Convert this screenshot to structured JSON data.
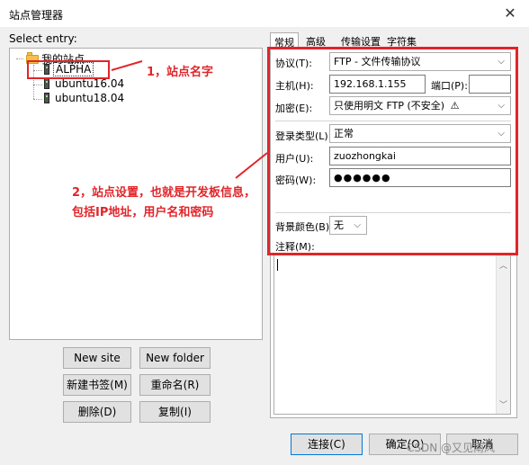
{
  "window": {
    "title": "站点管理器",
    "close_glyph": "✕"
  },
  "left": {
    "select_label": "Select entry:",
    "tree": {
      "root": "我的站点",
      "items": [
        "ALPHA",
        "ubuntu16.04",
        "ubuntu18.04"
      ]
    },
    "buttons": {
      "new_site": "New site",
      "new_folder": "New folder",
      "new_bookmark": "新建书签(M)",
      "rename": "重命名(R)",
      "delete": "删除(D)",
      "copy": "复制(I)"
    }
  },
  "tabs": [
    "常规",
    "高级",
    "传输设置",
    "字符集"
  ],
  "form": {
    "protocol": {
      "label": "协议(T):",
      "value": "FTP - 文件传输协议"
    },
    "host": {
      "label": "主机(H):",
      "value": "192.168.1.155"
    },
    "port": {
      "label": "端口(P):",
      "value": ""
    },
    "encryption": {
      "label": "加密(E):",
      "value": "只使用明文 FTP (不安全)",
      "warn_glyph": "⚠"
    },
    "logon_type": {
      "label": "登录类型(L):",
      "value": "正常"
    },
    "user": {
      "label": "用户(U):",
      "value": "zuozhongkai"
    },
    "password": {
      "label": "密码(W):",
      "value": "●●●●●●"
    },
    "bg_color": {
      "label": "背景颜色(B)",
      "value": "无"
    },
    "comments": {
      "label": "注释(M):",
      "value": ""
    }
  },
  "bottom_buttons": {
    "connect": "连接(C)",
    "ok": "确定(O)",
    "cancel": "取消"
  },
  "annotations": {
    "one": "1，站点名字",
    "two_line1": "2，站点设置，也就是开发板信息，",
    "two_line2": "包括IP地址，用户名和密码"
  },
  "watermark": "CSDN @又见南风",
  "colors": {
    "annotation": "#e0252a",
    "folder": "#f6c14a",
    "window_bg": "#f0f0f0"
  }
}
